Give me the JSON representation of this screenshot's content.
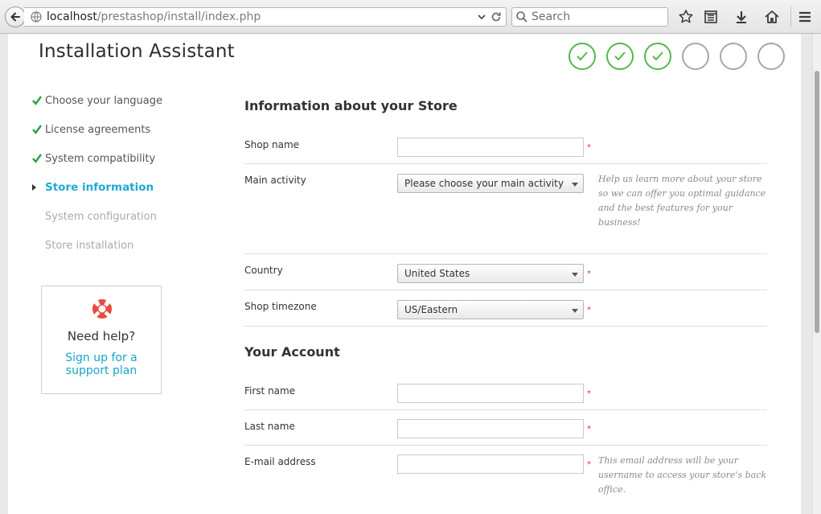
{
  "browser": {
    "url_host": "localhost",
    "url_path": "/prestashop/install/index.php",
    "search_placeholder": "Search"
  },
  "page": {
    "title": "Installation Assistant",
    "progress_steps_completed": 3,
    "progress_steps_total": 6
  },
  "nav": {
    "items": [
      {
        "label": "Choose your language",
        "state": "done"
      },
      {
        "label": "License agreements",
        "state": "done"
      },
      {
        "label": "System compatibility",
        "state": "done"
      },
      {
        "label": "Store information",
        "state": "active"
      },
      {
        "label": "System configuration",
        "state": "todo"
      },
      {
        "label": "Store installation",
        "state": "todo"
      }
    ]
  },
  "help": {
    "title": "Need help?",
    "link_line1": "Sign up for a",
    "link_line2": "support plan"
  },
  "store": {
    "section_title": "Information about your Store",
    "shop_name_label": "Shop name",
    "shop_name_value": "",
    "main_activity_label": "Main activity",
    "main_activity_value": "Please choose your main activity",
    "main_activity_hint": "Help us learn more about your store so we can offer you optimal guidance and the best features for your business!",
    "country_label": "Country",
    "country_value": "United States",
    "timezone_label": "Shop timezone",
    "timezone_value": "US/Eastern"
  },
  "account": {
    "section_title": "Your Account",
    "first_name_label": "First name",
    "first_name_value": "",
    "last_name_label": "Last name",
    "last_name_value": "",
    "email_label": "E-mail address",
    "email_value": "",
    "email_hint": "This email address will be your username to access your store's back office."
  },
  "required_marker": "*",
  "colors": {
    "accent": "#1eaad4",
    "done": "#52b848",
    "required": "#d9322e"
  }
}
